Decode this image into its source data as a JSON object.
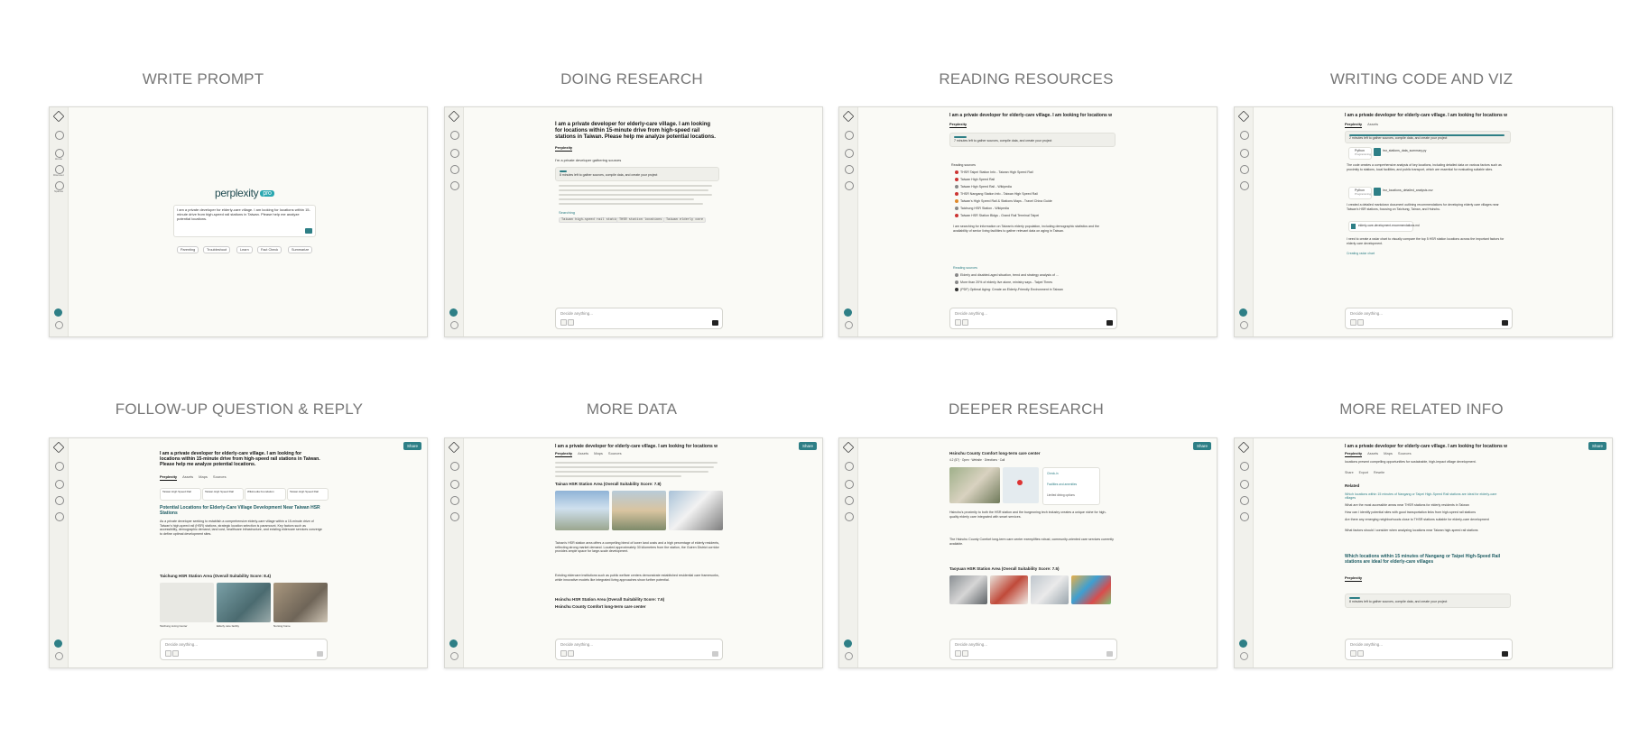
{
  "titles": {
    "write_prompt": "WRITE PROMPT",
    "doing_research": "DOING RESEARCH",
    "reading_resources": "READING RESOURCES",
    "writing_code": "WRITING CODE AND VIZ",
    "follow_up": "FOLLOW-UP QUESTION & REPLY",
    "more_data": "MORE DATA",
    "deeper_research": "DEEPER RESEARCH",
    "more_related": "MORE RELATED INFO"
  },
  "rail": {
    "home": "Home",
    "discover": "Discover",
    "spaces": "Spaces"
  },
  "query_short": "I am a private developer for elderly-care village. I am looking for locations within 15-...",
  "query_full": "I am a private developer for elderly-care village. I am looking for locations within 15-minute drive from high-speed rail stations in Taiwan. Please help me analyze potential locations.",
  "ask_placeholder": "Decide anything...",
  "share": "Share",
  "tabs": {
    "perplexity": "Perplexity",
    "assets": "Assets",
    "maps": "Maps",
    "sources": "Sources"
  },
  "write": {
    "logo": "perplexity",
    "logo_badge": "pro",
    "suggestions": [
      "Parenting",
      "Troubleshoot",
      "Learn",
      "Fact Check",
      "Summarize"
    ]
  },
  "research": {
    "status": "8 minutes left to gather sources, compile data, and create your project",
    "gathering": "I'm a private developer gathering sources",
    "searching": "Searching",
    "queries": [
      "Taiwan high-speed rail stations",
      "THSR station locations",
      "Taiwan elderly care"
    ]
  },
  "reading": {
    "status": "7 minutes left to gather sources, compile data, and create your project",
    "sources_label": "Reading sources",
    "sources": [
      "THSR Taipei Station Info - Taiwan High Speed Rail",
      "Taiwan High Speed Rail",
      "Taiwan High Speed Rail - Wikipedia",
      "THSR Nangang Station Info - Taiwan High Speed Rail",
      "Taiwan's High Speed Rail & Stations Maps - Travel China Guide",
      "Taichung HSR Station - Wikipedia",
      "Taiwan HSR Station Bldgs - Grand Rail Terminal Taipei"
    ],
    "next": "I am searching for information on Taiwan's elderly population, including demographic statistics and the availability of senior living facilities to gather relevant data on aging in Taiwan.",
    "reading_more": "Reading sources",
    "more_sources": [
      "Elderly and disabled-aged situation, trend and strategy analysis of ...",
      "More than 20% of elderly live alone, ministry says - Taipei Times",
      "(PDF) Optimal Aging: Create an Elderly-Friendly Environment in Taiwan"
    ]
  },
  "code": {
    "status": "2 minutes left to gather sources, compile data, and create your project",
    "file1": "hsr_stations_data_summary.py",
    "file2": "hsr_locations_detailed_analysis.csv",
    "file3": "elderly-care-development-recommendations.md",
    "lang": "Python",
    "programming": "Programming",
    "para1": "The code creates a comprehensive analysis of key locations, including detailed data on various factors such as proximity to stations, local facilities, and public transport, which are essential for evaluating suitable sites.",
    "para2": "I created a detailed markdown document outlining recommendations for developing elderly care villages near Taiwan's HSR stations, focusing on Taichung, Tainan, and Hsinchu.",
    "para3": "I need to create a radar chart to visually compare the top 5 HSR station locations across the important factors for elderly care development.",
    "creating": "Creating radar chart"
  },
  "follow": {
    "heading": "Potential Locations for Elderly-Care Village Development Near Taiwan HSR Stations",
    "intro": "As a private developer seeking to establish a comprehensive elderly-care village within a 15-minute drive of Taiwan's high-speed rail (HSR) stations, strategic location selection is paramount. Key factors such as accessibility, demographic demand, land cost, healthcare infrastructure, and existing eldercare services converge to define optimal development sites.",
    "section": "Taichung HSR Station Area (Overall Suitability Score: 8.4)",
    "cards": [
      "Taiwan High Speed Rail",
      "Taiwan High Speed Rail",
      "Wikimedia Foundation",
      "Taiwan High Speed Rail"
    ],
    "captions": [
      "Taichung Living Center",
      "Elderly care facility",
      "Nursing home"
    ]
  },
  "more": {
    "section1": "Tainan HSR Station Area (Overall Suitability Score: 7.8)",
    "p1": "Tainan's HSR station area offers a compelling blend of lower land costs and a high percentage of elderly residents, reflecting strong market demand. Located approximately 30 kilometers from the station, the Guiren District corridor provides ample space for large-scale development.",
    "p2": "Existing eldercare institutions such as public welfare centers demonstrate established residential care frameworks, while innovative models like integrated living approaches show further potential.",
    "section2": "Hsinchu HSR Station Area (Overall Suitability Score: 7.6)",
    "section3": "Hsinchu County Comfort long-term care center"
  },
  "deeper": {
    "heading": "Hsinchu County Comfort long-term care center",
    "meta": "4.2 (57) · Open · Website · Directions · Call",
    "options": [
      "Check-in",
      "Facilities and amenities",
      "Limited dining options"
    ],
    "p1": "Hsinchu's proximity to both the HSR station and the burgeoning tech industry creates a unique niche for high-quality elderly care integrated with smart services.",
    "p2": "The Hsinchu County Comfort long-term care center exemplifies robust, community-oriented care services currently available.",
    "section": "Taoyuan HSR Station Area (Overall Suitability Score: 7.5)"
  },
  "related": {
    "top": "locations present compelling opportunities for sustainable, high-impact village development.",
    "actions": [
      "Share",
      "Export",
      "Rewrite"
    ],
    "heading": "Related",
    "items": [
      "Which locations within 15 minutes of Nangang or Taipei High-Speed Rail stations are ideal for elderly-care villages",
      "What are the most accessible areas near THSR stations for elderly residents in Taiwan",
      "How can I identify potential sites with good transportation links from high-speed rail stations",
      "Are there any emerging neighborhoods close to THSR stations suitable for elderly-care development",
      "What factors should I consider when analyzing locations near Taiwan high-speed rail stations"
    ],
    "question": "Which locations within 15 minutes of Nangang or Taipei High-Speed Rail stations are ideal for elderly-care villages",
    "status": "8 minutes left to gather sources, compile data, and create your project"
  },
  "colors": {
    "accent": "#2e7f86",
    "bg": "#fafaf6"
  }
}
